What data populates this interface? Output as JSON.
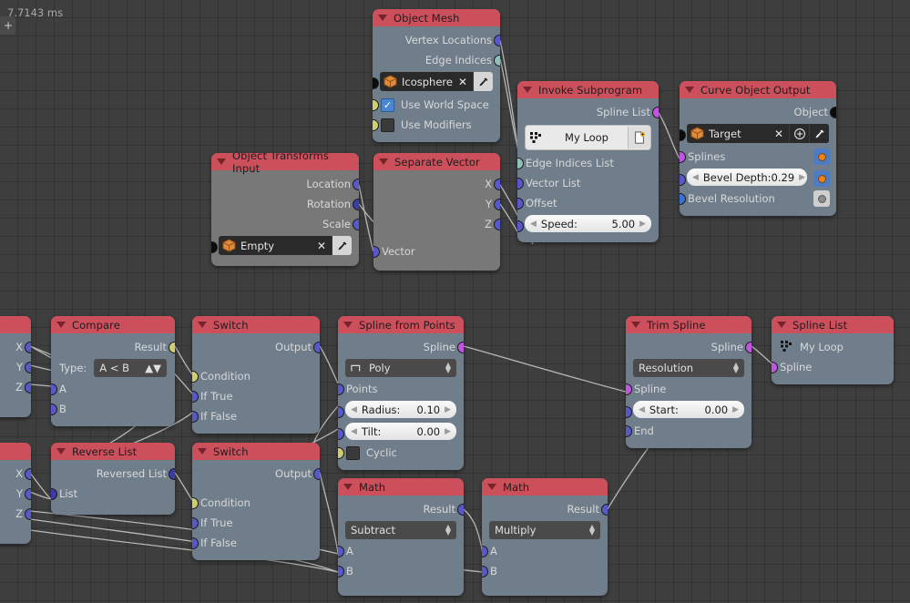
{
  "overlay": {
    "timing": "7.7143 ms",
    "corner_icon": "plus-icon"
  },
  "nodes": [
    {
      "id": "object-mesh",
      "title": "Object Mesh",
      "outputs": [
        "Vertex Locations",
        "Edge Indices"
      ],
      "object_field": {
        "value": "Icosphere",
        "clear": "✕",
        "picker_icon": "eyedropper-icon"
      },
      "checkboxes": [
        {
          "label": "Use World Space",
          "checked": true
        },
        {
          "label": "Use Modifiers",
          "checked": false
        }
      ]
    },
    {
      "id": "invoke-subprogram",
      "title": "Invoke Subprogram",
      "outputs": [
        "Spline List"
      ],
      "subprogram": {
        "name": "My Loop",
        "list_icon": "dots-grid-icon",
        "new_icon": "new-file-icon"
      },
      "inputs": [
        "Edge Indices List",
        "Vector List",
        "Offset"
      ],
      "slider": {
        "label": "Speed:",
        "value": "5.00"
      }
    },
    {
      "id": "curve-object-output",
      "title": "Curve Object Output",
      "outputs": [
        "Object"
      ],
      "object_field": {
        "value": "Target",
        "clear": "✕",
        "add_icon": "plus-circle-icon",
        "picker_icon": "eyedropper-icon"
      },
      "inputs": [
        "Splines",
        "Bevel Resolution"
      ],
      "slider": {
        "label": "Bevel Depth:",
        "value": "0.29"
      }
    },
    {
      "id": "object-transforms-input",
      "title": "Object Transforms Input",
      "outputs": [
        "Location",
        "Rotation",
        "Scale"
      ],
      "object_field": {
        "value": "Empty",
        "clear": "✕",
        "picker_icon": "eyedropper-icon"
      }
    },
    {
      "id": "separate-vector",
      "title": "Separate Vector",
      "outputs": [
        "X",
        "Y",
        "Z"
      ],
      "inputs": [
        "Vector"
      ]
    },
    {
      "id": "compare",
      "title": "Compare",
      "outputs": [
        "Result"
      ],
      "type_label": "Type:",
      "type_value": "A < B",
      "inputs": [
        "A",
        "B"
      ]
    },
    {
      "id": "switch-top",
      "title": "Switch",
      "outputs": [
        "Output"
      ],
      "inputs": [
        "Condition",
        "If True",
        "If False"
      ]
    },
    {
      "id": "spline-from-points",
      "title": "Spline from Points",
      "outputs": [
        "Spline"
      ],
      "dropdown": "Poly",
      "inputs": [
        "Points"
      ],
      "sliders": [
        {
          "label": "Radius:",
          "value": "0.10"
        },
        {
          "label": "Tilt:",
          "value": "0.00"
        }
      ],
      "checkboxes": [
        {
          "label": "Cyclic",
          "checked": false
        }
      ]
    },
    {
      "id": "trim-spline",
      "title": "Trim Spline",
      "outputs": [
        "Spline"
      ],
      "dropdown": "Resolution",
      "inputs": [
        "Spline",
        "End"
      ],
      "slider": {
        "label": "Start:",
        "value": "0.00"
      }
    },
    {
      "id": "spline-list",
      "title": "Spline List",
      "loop_name": "My Loop",
      "inputs": [
        "Spline"
      ]
    },
    {
      "id": "reverse-list",
      "title": "Reverse List",
      "outputs": [
        "Reversed List"
      ],
      "inputs": [
        "List"
      ]
    },
    {
      "id": "switch-bottom",
      "title": "Switch",
      "outputs": [
        "Output"
      ],
      "inputs": [
        "Condition",
        "If True",
        "If False"
      ]
    },
    {
      "id": "math-subtract",
      "title": "Math",
      "outputs": [
        "Result"
      ],
      "dropdown": "Subtract",
      "inputs": [
        "A",
        "B"
      ]
    },
    {
      "id": "math-multiply",
      "title": "Math",
      "outputs": [
        "Result"
      ],
      "dropdown": "Multiply",
      "inputs": [
        "A",
        "B"
      ]
    },
    {
      "id": "partial-left-top",
      "title": "",
      "outputs": [
        "X",
        "Y",
        "Z"
      ]
    },
    {
      "id": "partial-left-bottom",
      "title": "",
      "outputs": [
        "X",
        "Y",
        "Z"
      ]
    }
  ],
  "colors": {
    "header": "#cc4f5c",
    "body": "#707e8c",
    "background": "#3e3e3e",
    "socket_vector": "#5858c8",
    "socket_boolean": "#cfcf72",
    "socket_list": "#c154e0",
    "socket_edge": "#8fbfb8",
    "socket_object": "#0b0b0b",
    "link": "#c8c8c8"
  }
}
